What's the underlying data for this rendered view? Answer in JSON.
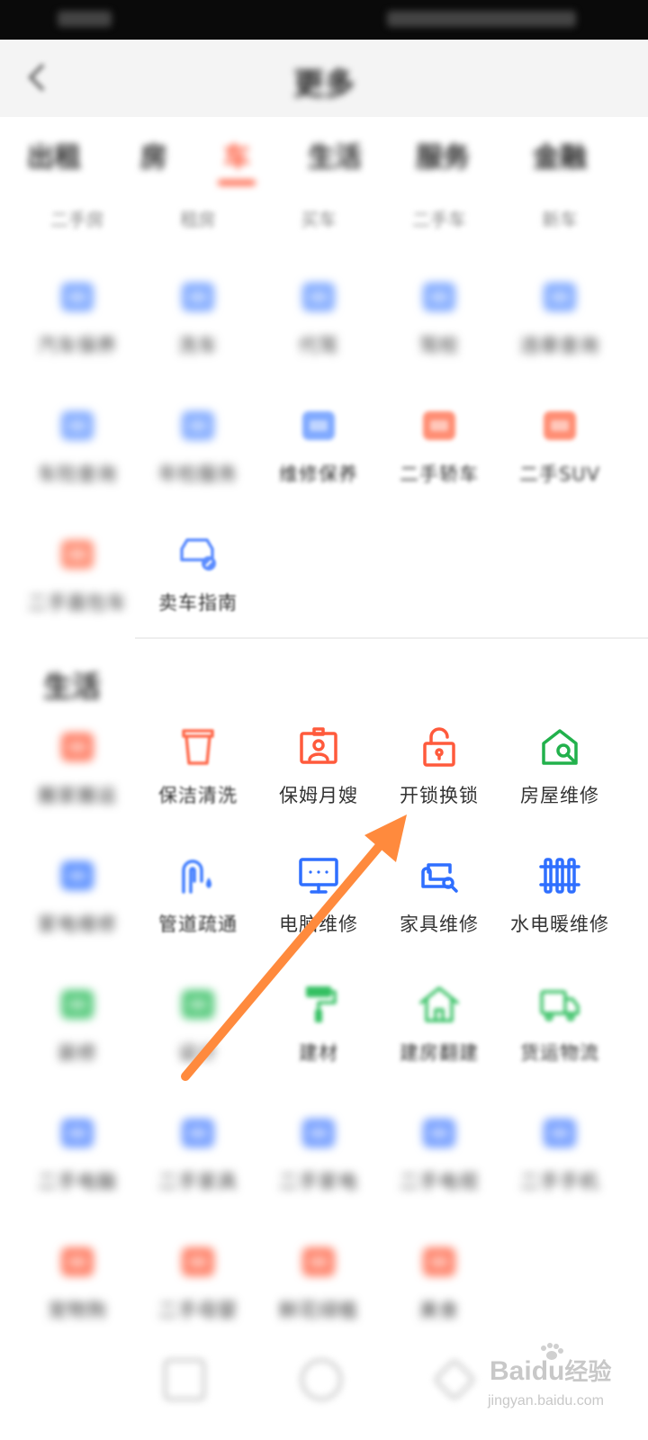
{
  "header": {
    "title": "更多"
  },
  "top_tabs": [
    "出租",
    "房",
    "车",
    "生活",
    "服务",
    "金融"
  ],
  "sub_row": [
    "二手房",
    "租房",
    "买车",
    "二手车",
    "新车"
  ],
  "vehicle_section": {
    "items": [
      {
        "label": "汽车保养",
        "icon": "car-service-icon",
        "color": "#6b9bff"
      },
      {
        "label": "洗车",
        "icon": "car-wash-icon",
        "color": "#6b9bff"
      },
      {
        "label": "代驾",
        "icon": "driver-icon",
        "color": "#6b9bff"
      },
      {
        "label": "驾校",
        "icon": "driving-school-icon",
        "color": "#6b9bff"
      },
      {
        "label": "违章查询",
        "icon": "violation-icon",
        "color": "#6b9bff"
      },
      {
        "label": "车险查询",
        "icon": "car-insurance-icon",
        "color": "#6b9bff"
      },
      {
        "label": "年检服务",
        "icon": "inspection-icon",
        "color": "#6b9bff"
      },
      {
        "label": "维修保养",
        "icon": "repair-maintenance-icon",
        "color": "#6b9bff"
      },
      {
        "label": "二手轿车",
        "icon": "used-sedan-icon",
        "color": "#ff7a5c"
      },
      {
        "label": "二手SUV",
        "icon": "used-suv-icon",
        "color": "#ff7a5c"
      },
      {
        "label": "二手面包车",
        "icon": "used-van-icon",
        "color": "#ff7a5c"
      },
      {
        "label": "卖车指南",
        "icon": "sell-car-guide-icon",
        "color": "#5b8cff"
      }
    ]
  },
  "life_section": {
    "title": "生活",
    "items": [
      {
        "label": "搬家搬运",
        "icon": "moving-icon",
        "color": "#ff6a4c"
      },
      {
        "label": "保洁清洗",
        "icon": "cleaning-icon",
        "color": "#ff6a4c"
      },
      {
        "label": "保姆月嫂",
        "icon": "nanny-icon",
        "color": "#ff5a3c"
      },
      {
        "label": "开锁换锁",
        "icon": "unlock-icon",
        "color": "#ff5a3c"
      },
      {
        "label": "房屋维修",
        "icon": "house-repair-icon",
        "color": "#22b14c"
      },
      {
        "label": "家电维修",
        "icon": "appliance-repair-icon",
        "color": "#3d7bff"
      },
      {
        "label": "管道疏通",
        "icon": "pipe-icon",
        "color": "#3d7bff"
      },
      {
        "label": "电脑维修",
        "icon": "computer-repair-icon",
        "color": "#2f6fff"
      },
      {
        "label": "家具维修",
        "icon": "furniture-repair-icon",
        "color": "#2f6fff"
      },
      {
        "label": "水电暖维修",
        "icon": "heating-repair-icon",
        "color": "#2f6fff"
      },
      {
        "label": "装修",
        "icon": "decoration-icon",
        "color": "#34c062"
      },
      {
        "label": "设计",
        "icon": "design-icon",
        "color": "#34c062"
      },
      {
        "label": "建材",
        "icon": "paint-roller-icon",
        "color": "#34c062"
      },
      {
        "label": "建房翻建",
        "icon": "house-build-icon",
        "color": "#34c062"
      },
      {
        "label": "货运物流",
        "icon": "truck-icon",
        "color": "#34c062"
      },
      {
        "label": "二手电脑",
        "icon": "used-computer-icon",
        "color": "#5b8cff"
      },
      {
        "label": "二手家具",
        "icon": "used-furniture-icon",
        "color": "#5b8cff"
      },
      {
        "label": "二手家电",
        "icon": "used-appliance-icon",
        "color": "#5b8cff"
      },
      {
        "label": "二手电视",
        "icon": "used-tv-icon",
        "color": "#5b8cff"
      },
      {
        "label": "二手手机",
        "icon": "used-phone-icon",
        "color": "#5b8cff"
      },
      {
        "label": "宠物狗",
        "icon": "pet-icon",
        "color": "#ff6a4c"
      },
      {
        "label": "二手母婴",
        "icon": "baby-icon",
        "color": "#ff6a4c"
      },
      {
        "label": "鲜花绿植",
        "icon": "flower-icon",
        "color": "#ff6a4c"
      },
      {
        "label": "美食",
        "icon": "food-icon",
        "color": "#ff6a4c"
      }
    ]
  },
  "watermark": {
    "brand": "Bai",
    "brand_cn": "经验",
    "url": "jingyan.baidu.com"
  }
}
